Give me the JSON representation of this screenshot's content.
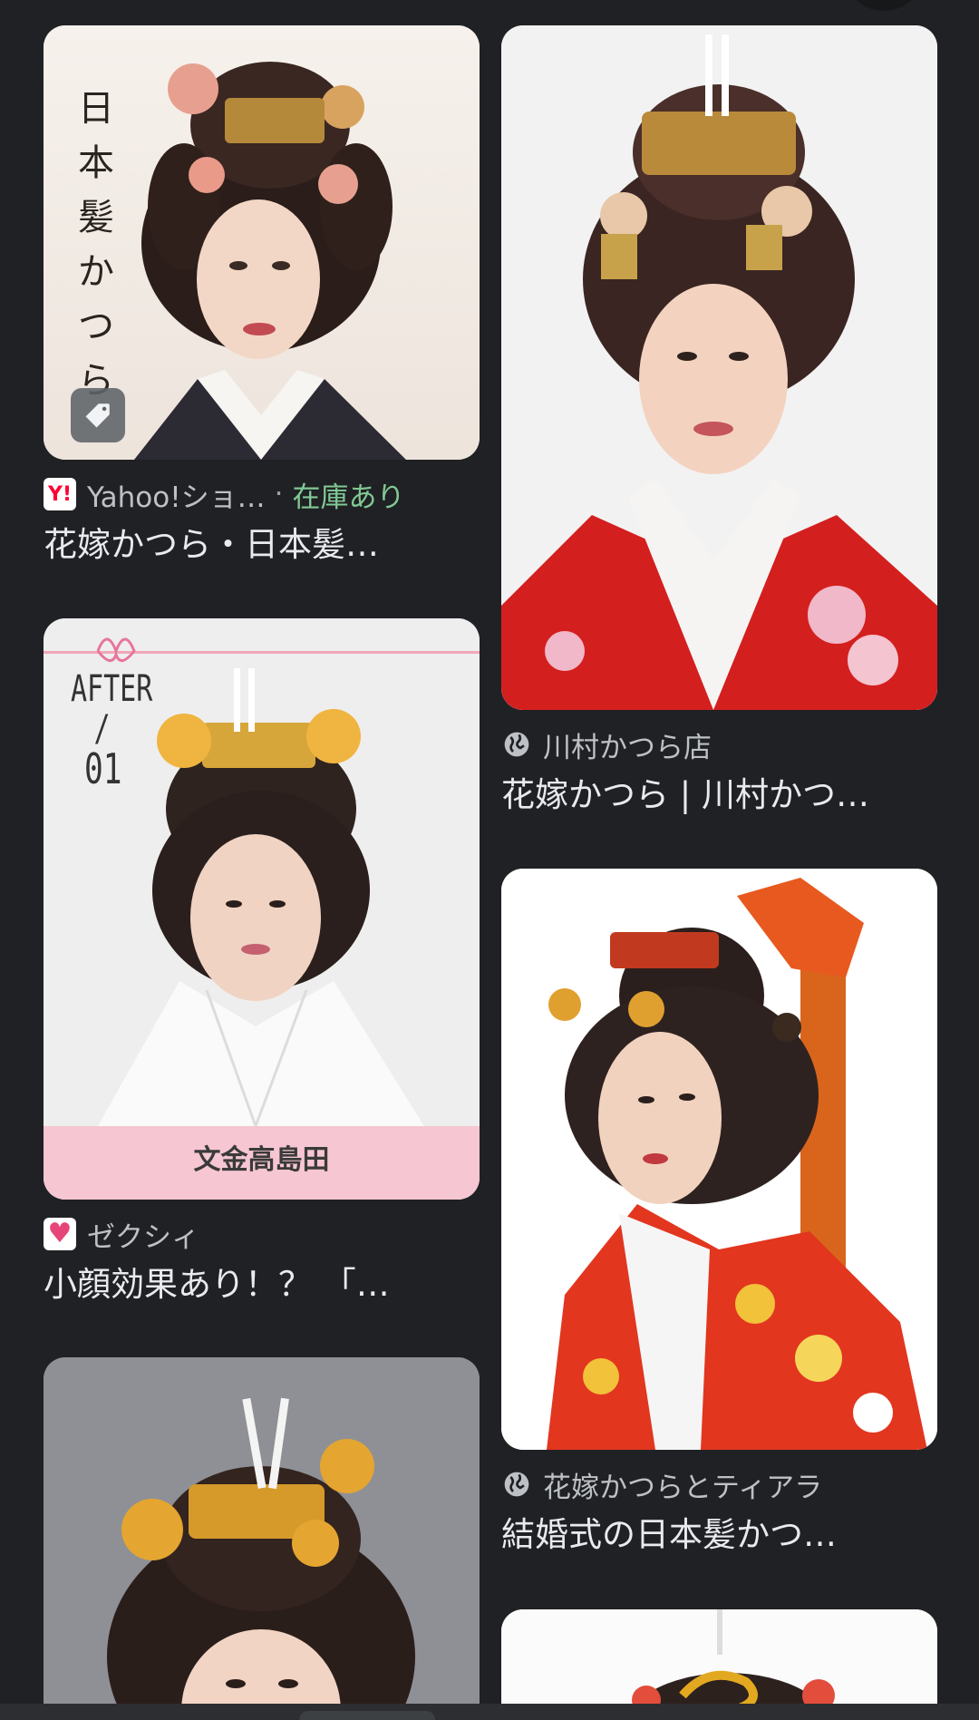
{
  "results": [
    {
      "source": "Yahoo!ショ…",
      "separator": "·",
      "stock_label": "在庫あり",
      "title": "花嫁かつら・日本髪…",
      "image_text": "日本髪かつら",
      "favicon": "yahoo-favicon",
      "badge_icon": "tag-icon"
    },
    {
      "source": "川村かつら店",
      "title": "花嫁かつら | 川村かつ…",
      "favicon": "globe-icon"
    },
    {
      "source": "ゼクシィ",
      "title": "小顔効果あり！？ 「…",
      "image_text_top": "AFTER",
      "image_text_slash": "/",
      "image_text_num": "01",
      "image_caption": "文金高島田",
      "favicon": "zexy-favicon"
    },
    {
      "source": "花嫁かつらとティアラ",
      "title": "結婚式の日本髪かつ…",
      "favicon": "globe-icon"
    }
  ],
  "colors": {
    "background": "#202124",
    "stock_green": "#81c995",
    "source_gray": "#bdc1c6",
    "title_white": "#e8eaed"
  }
}
